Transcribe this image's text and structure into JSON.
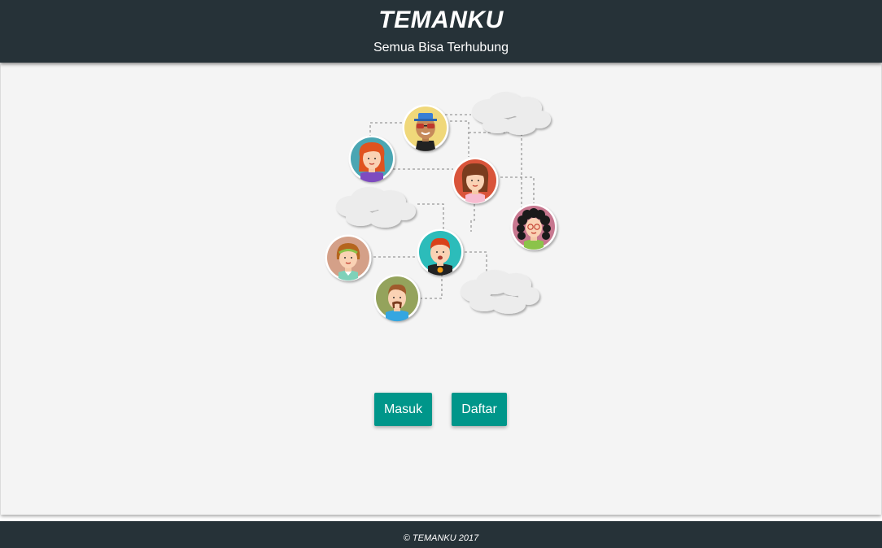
{
  "header": {
    "title": "TEMANKU",
    "subtitle": "Semua Bisa Terhubung"
  },
  "actions": {
    "login_label": "Masuk",
    "register_label": "Daftar"
  },
  "footer": {
    "copyright": "© TEMANKU 2017"
  },
  "colors": {
    "header_bg": "#263238",
    "button_bg": "#00968a",
    "main_bg": "#f4f4f4"
  },
  "illustration": {
    "icon": "connected-friends-network-icon"
  }
}
